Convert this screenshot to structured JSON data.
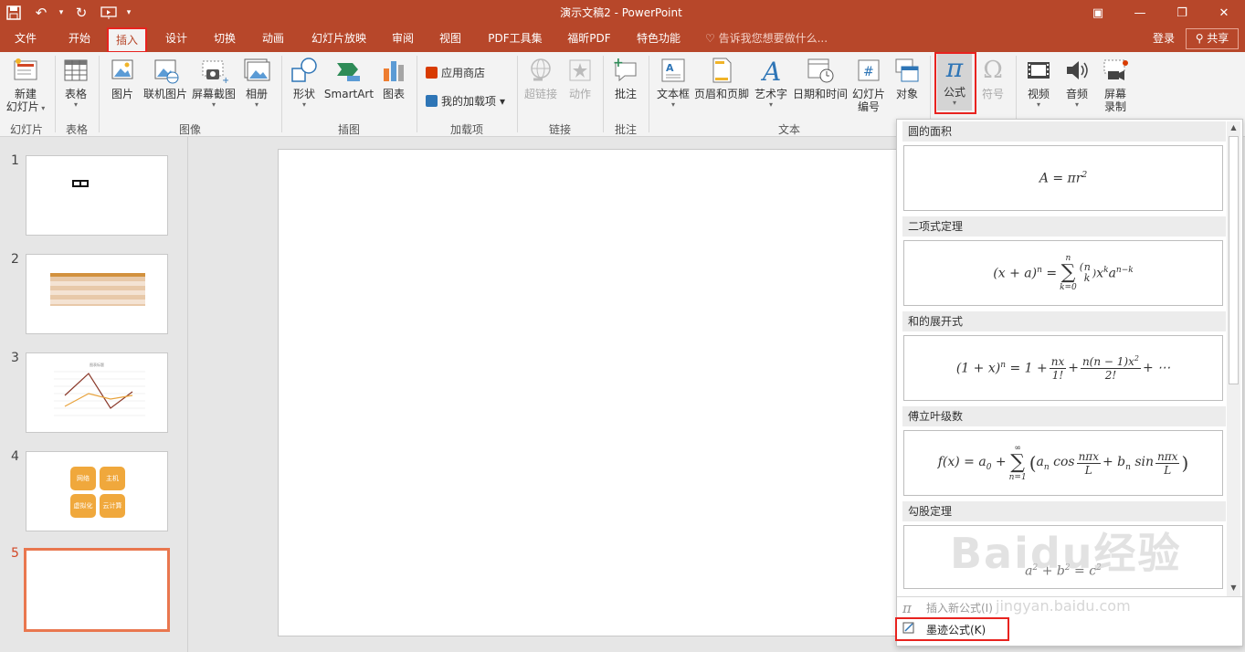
{
  "window": {
    "title": "演示文稿2 - PowerPoint"
  },
  "tabs": [
    "文件",
    "开始",
    "插入",
    "设计",
    "切换",
    "动画",
    "幻灯片放映",
    "审阅",
    "视图",
    "PDF工具集",
    "福昕PDF",
    "特色功能"
  ],
  "active_tab": "插入",
  "tell_me": "告诉我您想要做什么...",
  "account": {
    "login": "登录",
    "share": "共享"
  },
  "ribbon": {
    "new_slide": {
      "line1": "新建",
      "line2": "幻灯片"
    },
    "table": "表格",
    "picture": "图片",
    "online_picture": "联机图片",
    "screenshot": "屏幕截图",
    "album": "相册",
    "shapes": "形状",
    "smartart": "SmartArt",
    "chart": "图表",
    "store": "应用商店",
    "my_addins": "我的加载项",
    "hyperlink": "超链接",
    "action": "动作",
    "comment": "批注",
    "textbox": "文本框",
    "header_footer": "页眉和页脚",
    "wordart": "艺术字",
    "datetime": "日期和时间",
    "slide_number": {
      "line1": "幻灯片",
      "line2": "编号"
    },
    "object": "对象",
    "equation": "公式",
    "symbol": "符号",
    "video": "视频",
    "audio": "音频",
    "screen_record": {
      "line1": "屏幕",
      "line2": "录制"
    },
    "groups": {
      "slides": "幻灯片",
      "tables": "表格",
      "images": "图像",
      "illustrations": "插图",
      "addins": "加载项",
      "links": "链接",
      "comments": "批注",
      "text": "文本"
    }
  },
  "slides": [
    {
      "number": "1"
    },
    {
      "number": "2"
    },
    {
      "number": "3",
      "chart_title": "图表标题"
    },
    {
      "number": "4",
      "cells": [
        "网络",
        "主机",
        "虚拟化",
        "云计算"
      ]
    },
    {
      "number": "5"
    }
  ],
  "equation_gallery": {
    "items": [
      {
        "title": "圆的面积"
      },
      {
        "title": "二项式定理"
      },
      {
        "title": "和的展开式"
      },
      {
        "title": "傅立叶级数"
      },
      {
        "title": "勾股定理"
      }
    ],
    "insert_new": "插入新公式(I)",
    "ink_equation": "墨迹公式(K)"
  },
  "watermark": {
    "text": "Baidu经验",
    "url": "jingyan.baidu.com"
  }
}
